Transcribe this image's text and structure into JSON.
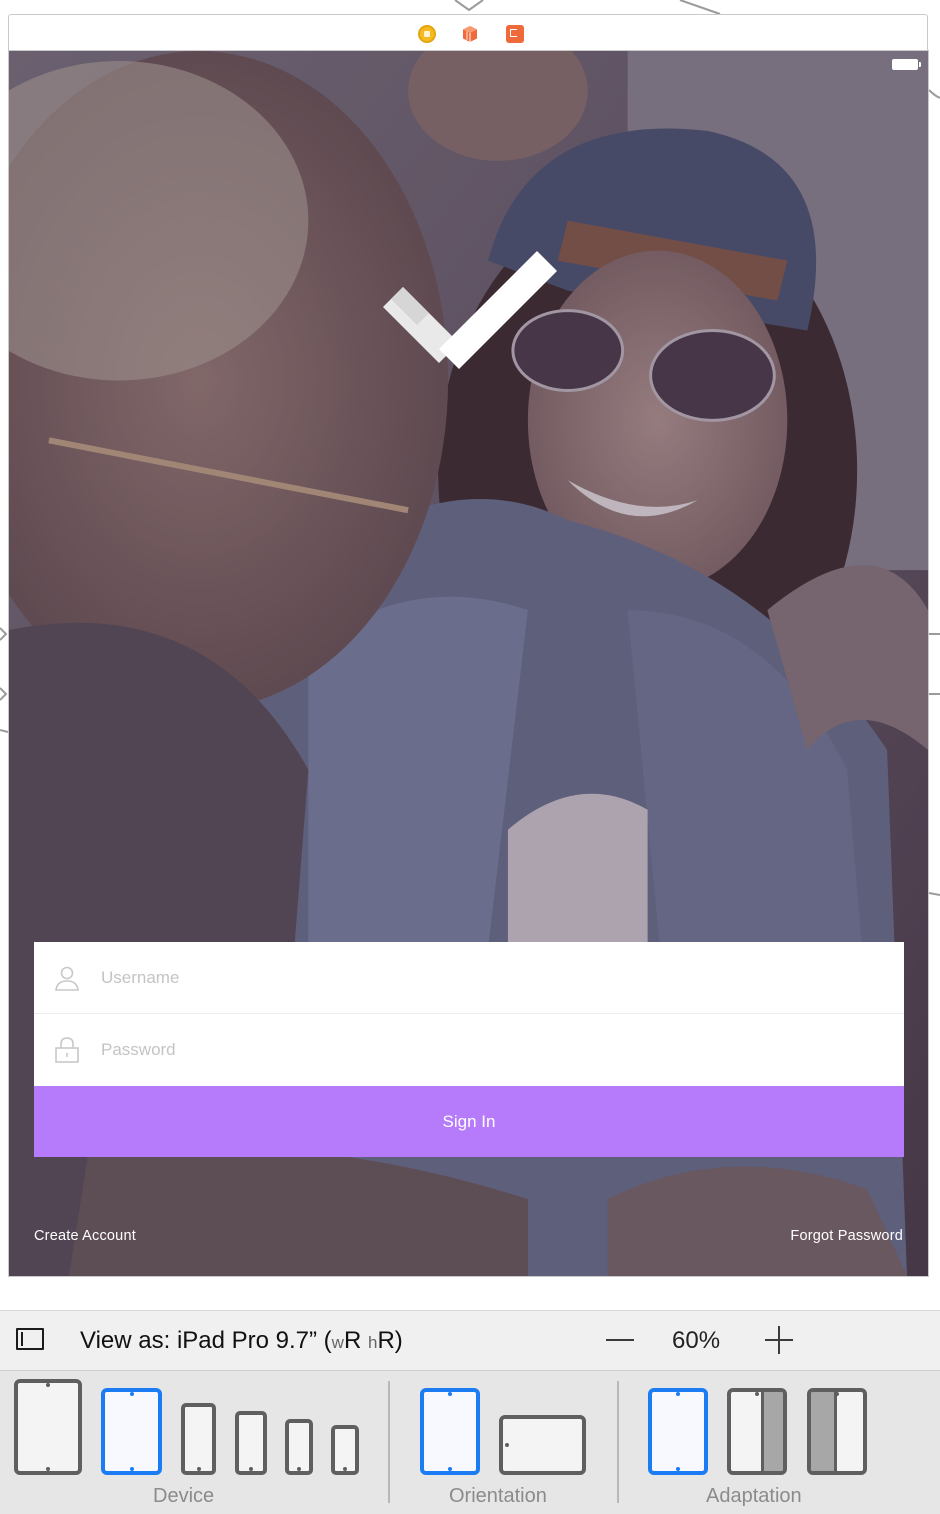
{
  "scene": {
    "icons": [
      "view-controller-icon",
      "first-responder-icon",
      "exit-icon"
    ]
  },
  "status_bar": {
    "icon": "battery-icon"
  },
  "logo": {
    "icon": "checkmark-logo-icon"
  },
  "login": {
    "username_placeholder": "Username",
    "password_placeholder": "Password",
    "signin_label": "Sign In",
    "signin_color": "#b57bfa"
  },
  "links": {
    "create_account": "Create Account",
    "forgot_password": "Forgot Password"
  },
  "toolbar": {
    "view_as_prefix": "View as: iPad Pro 9.7” (",
    "w": "w",
    "w_class": "R",
    "h": "h",
    "h_class": "R",
    "view_as_suffix": ")",
    "zoom": "60%"
  },
  "device_panel": {
    "device_label": "Device",
    "orientation_label": "Orientation",
    "adaptation_label": "Adaptation",
    "selected_color": "#1c7cf4"
  }
}
